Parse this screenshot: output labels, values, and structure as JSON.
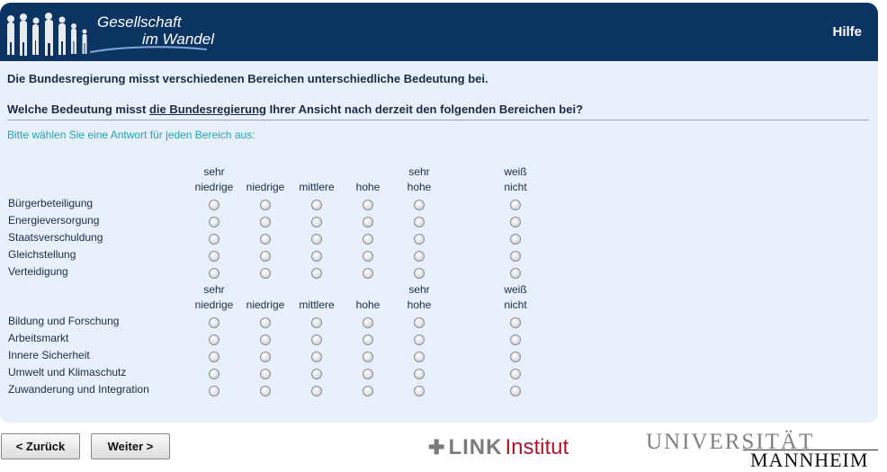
{
  "header": {
    "logo_line1": "Gesellschaft",
    "logo_line2": "im Wandel",
    "help_label": "Hilfe"
  },
  "question": {
    "intro": "Die Bundesregierung misst verschiedenen Bereichen unterschiedliche Bedeutung bei.",
    "question_pre": "Welche Bedeutung misst ",
    "question_underlined": "die Bundesregierung",
    "question_post": " Ihrer Ansicht nach derzeit den folgenden Bereichen bei?",
    "instruction": "Bitte wählen Sie eine Antwort für jeden Bereich aus:"
  },
  "columns": [
    {
      "line1": "sehr",
      "line2": "niedrige"
    },
    {
      "line1": "",
      "line2": "niedrige"
    },
    {
      "line1": "",
      "line2": "mittlere"
    },
    {
      "line1": "",
      "line2": "hohe"
    },
    {
      "line1": "sehr",
      "line2": "hohe"
    },
    {
      "line1": "weiß",
      "line2": "nicht"
    }
  ],
  "groups": [
    {
      "rows": [
        "Bürgerbeteiligung",
        "Energieversorgung",
        "Staatsverschuldung",
        "Gleichstellung",
        "Verteidigung"
      ]
    },
    {
      "rows": [
        "Bildung und Forschung",
        "Arbeitsmarkt",
        "Innere Sicherheit",
        "Umwelt und Klimaschutz",
        "Zuwanderung und Integration"
      ]
    }
  ],
  "nav": {
    "back_label": "< Zurück",
    "next_label": "Weiter >"
  },
  "footer": {
    "link_mark": "✚",
    "link_bold": "LINK",
    "link_institut": "Institut",
    "uni_line1": "UNIVERSITÄT",
    "uni_line2": "MANNHEIM"
  }
}
